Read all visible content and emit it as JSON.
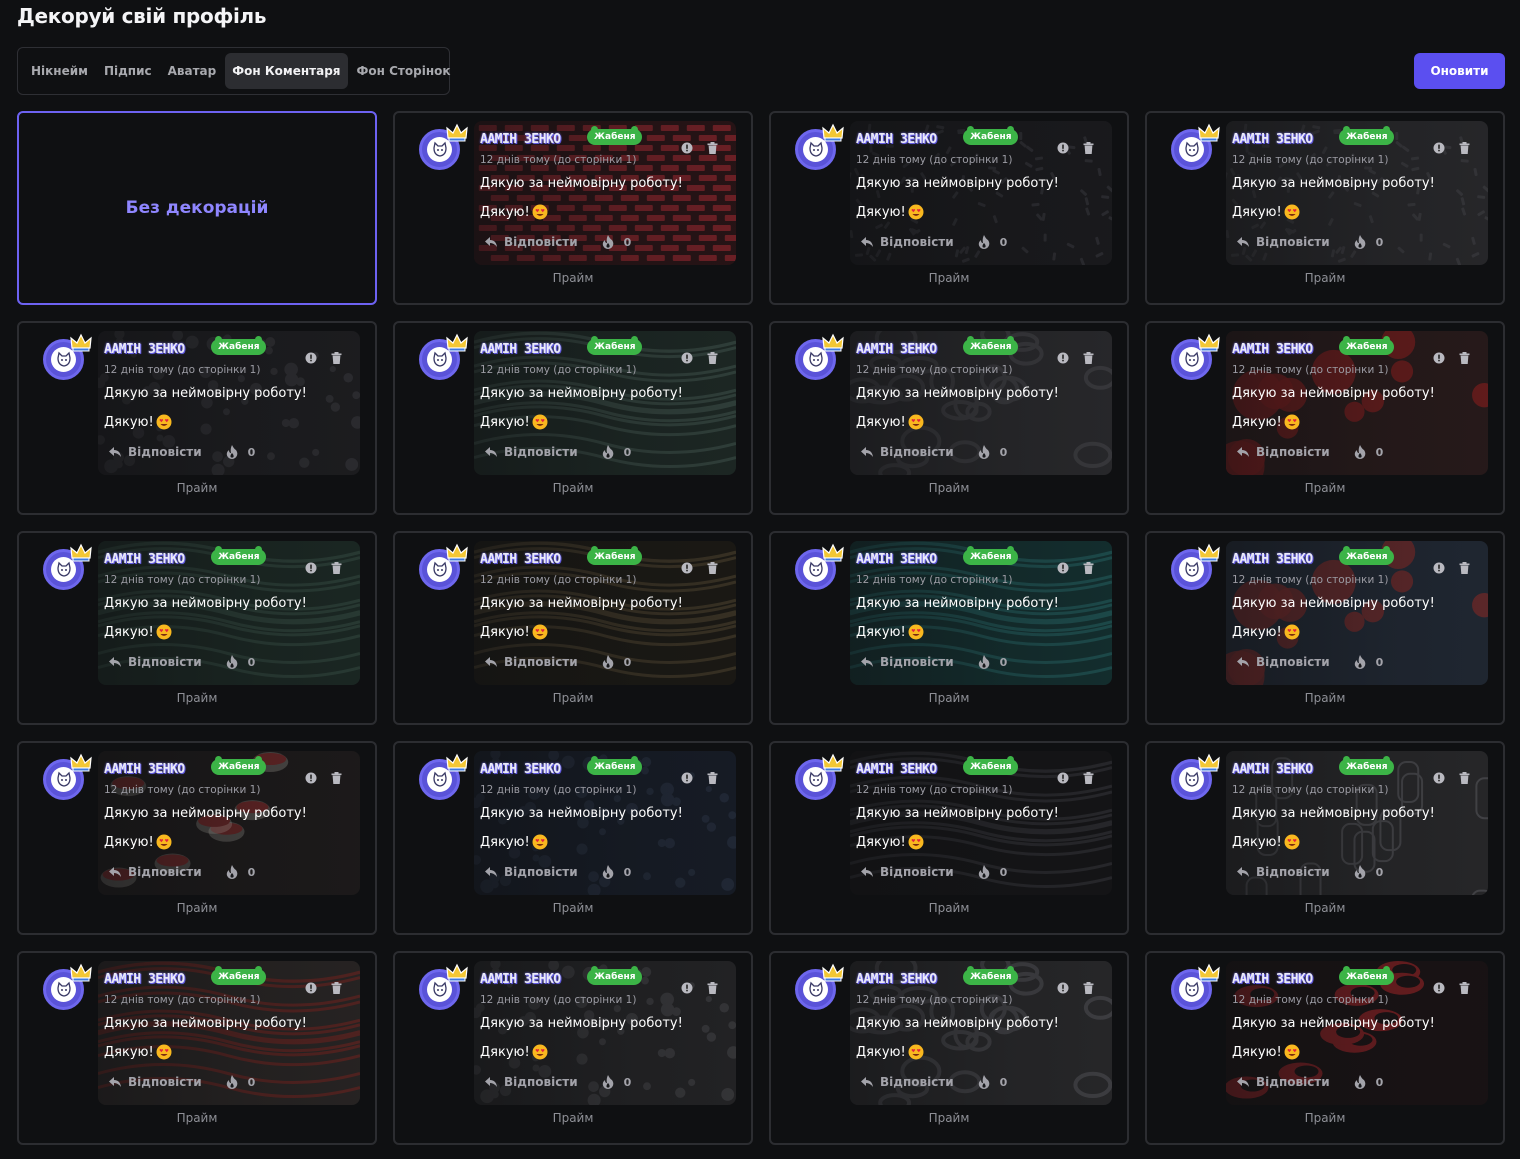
{
  "page": {
    "title": "Декоруй свій профіль"
  },
  "tabs": [
    {
      "label": "Нікнейм",
      "active": false
    },
    {
      "label": "Підпис",
      "active": false
    },
    {
      "label": "Аватар",
      "active": false
    },
    {
      "label": "Фон Коментаря",
      "active": true
    },
    {
      "label": "Фон Сторінок",
      "active": false
    }
  ],
  "update_button": {
    "label": "Оновити"
  },
  "no_decor": {
    "label": "Без декорацій"
  },
  "comment_preview": {
    "username": "AAMIH 3EHKO",
    "badge": "Жабеня",
    "time": "12 днів тому (до сторінки 1)",
    "text_line1": "Дякую за неймовірну роботу!",
    "text_line2": "Дякую!",
    "reply_label": "Відповісти",
    "reactions_count": "0"
  },
  "colors": {
    "accent": "#5b4ff0",
    "selected_border": "#6d62f2",
    "badge_green": "#3cb447",
    "avatar_blue": "#5a53d8"
  },
  "decorations": [
    {
      "label": "Прайм",
      "theme": "red-stripes"
    },
    {
      "label": "Прайм",
      "theme": "dark-ornament"
    },
    {
      "label": "Прайм",
      "theme": "gray-pattern"
    },
    {
      "label": "Прайм",
      "theme": "dark-ghosts"
    },
    {
      "label": "Прайм",
      "theme": "green-sketch"
    },
    {
      "label": "Прайм",
      "theme": "gray-waves"
    },
    {
      "label": "Прайм",
      "theme": "red-roses"
    },
    {
      "label": "Прайм",
      "theme": "green-dragon"
    },
    {
      "label": "Прайм",
      "theme": "gold-waves"
    },
    {
      "label": "Прайм",
      "theme": "teal-waves"
    },
    {
      "label": "Прайм",
      "theme": "sakura-blue"
    },
    {
      "label": "Прайм",
      "theme": "sushi"
    },
    {
      "label": "Прайм",
      "theme": "navy-anime"
    },
    {
      "label": "Прайм",
      "theme": "doodle"
    },
    {
      "label": "Прайм",
      "theme": "manga-gray"
    },
    {
      "label": "Прайм",
      "theme": "red-crane"
    },
    {
      "label": "Прайм",
      "theme": "chibi-faces"
    },
    {
      "label": "Прайм",
      "theme": "food-sketch"
    },
    {
      "label": "Прайм",
      "theme": "akatsuki-clouds"
    }
  ]
}
